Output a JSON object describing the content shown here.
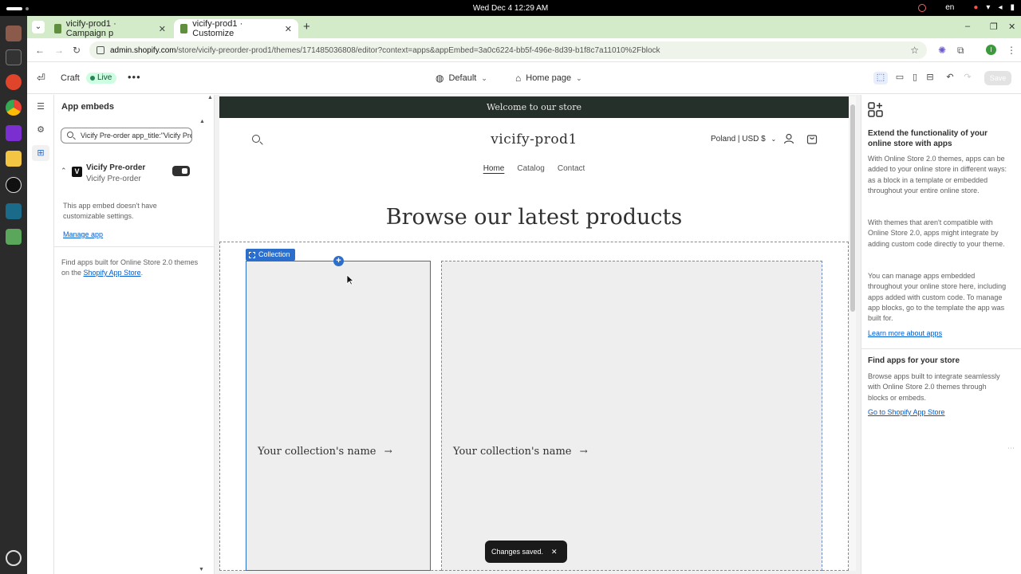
{
  "os": {
    "clock": "Wed Dec 4  12:29 AM",
    "lang": "en"
  },
  "browser": {
    "tabs": [
      {
        "title": "vicify-prod1 · Campaign p",
        "active": false
      },
      {
        "title": "vicify-prod1 · Customize",
        "active": true
      }
    ],
    "url_host": "admin.shopify.com",
    "url_path": "/store/vicify-preorder-prod1/themes/171485036808/editor?context=apps&appEmbed=3a0c6224-bb5f-496e-8d39-b1f8c7a11010%2Fblock",
    "profile_initial": "I"
  },
  "editor": {
    "theme_name": "Craft",
    "live_label": "Live",
    "preset_label": "Default",
    "page_label": "Home page",
    "save_label": "Save"
  },
  "left_panel": {
    "title": "App embeds",
    "search_value": "Vicify Pre-order app_title:\"Vicify Pre-order",
    "app_name": "Vicify Pre-order",
    "app_sub": "Vicify Pre-order",
    "app_logo": "V",
    "note": "This app embed doesn't have customizable settings.",
    "manage_link": "Manage app",
    "find_text": "Find apps built for Online Store 2.0 themes on the",
    "find_link": "Shopify App Store",
    "find_end": "."
  },
  "store": {
    "announcement": "Welcome to our store",
    "logo": "vicify-prod1",
    "country": "Poland | USD $",
    "nav": [
      "Home",
      "Catalog",
      "Contact"
    ],
    "heading": "Browse our latest products",
    "section_tag": "Collection",
    "collections": [
      "Your collection's name",
      "Your collection's name"
    ],
    "arrow": "→",
    "toast": "Changes saved.",
    "toast_close": "✕"
  },
  "right_panel": {
    "title": "Extend the functionality of your online store with apps",
    "p1": "With Online Store 2.0 themes, apps can be added to your online store in different ways: as a block in a template or embedded throughout your entire online store.",
    "p2": "With themes that aren't compatible with Online Store 2.0, apps might integrate by adding custom code directly to your theme.",
    "p3": "You can manage apps embedded throughout your online store here, including apps added with custom code. To manage app blocks, go to the template the app was built for.",
    "link1": "Learn more about apps",
    "title2": "Find apps for your store",
    "p4": "Browse apps built to integrate seamlessly with Online Store 2.0 themes through blocks or embeds.",
    "link2": "Go to Shopify App Store"
  },
  "colors": {
    "accent": "#2c6ecb",
    "tabbar": "#d3ebc9",
    "announcement": "#26302b",
    "live_badge": "#cdfee1"
  }
}
